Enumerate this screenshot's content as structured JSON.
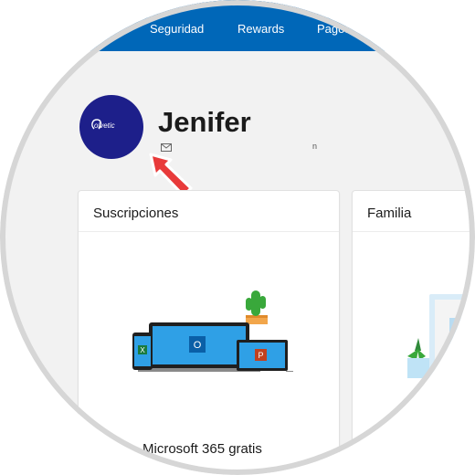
{
  "nav": {
    "items": [
      {
        "label": "Seguridad"
      },
      {
        "label": "Rewards"
      },
      {
        "label": "Pagos"
      }
    ]
  },
  "profile": {
    "name": "Jenifer",
    "email_fragment": "n",
    "avatar_text": "olvetic",
    "mail_icon": "mail-icon"
  },
  "cards": {
    "subscriptions": {
      "title": "Suscripciones",
      "footer": "Microsoft 365 gratis"
    },
    "family": {
      "title": "Familia"
    }
  },
  "colors": {
    "nav_bg": "#0067b8",
    "avatar_bg": "#1d1f8a",
    "pointer": "#e83a3a"
  }
}
